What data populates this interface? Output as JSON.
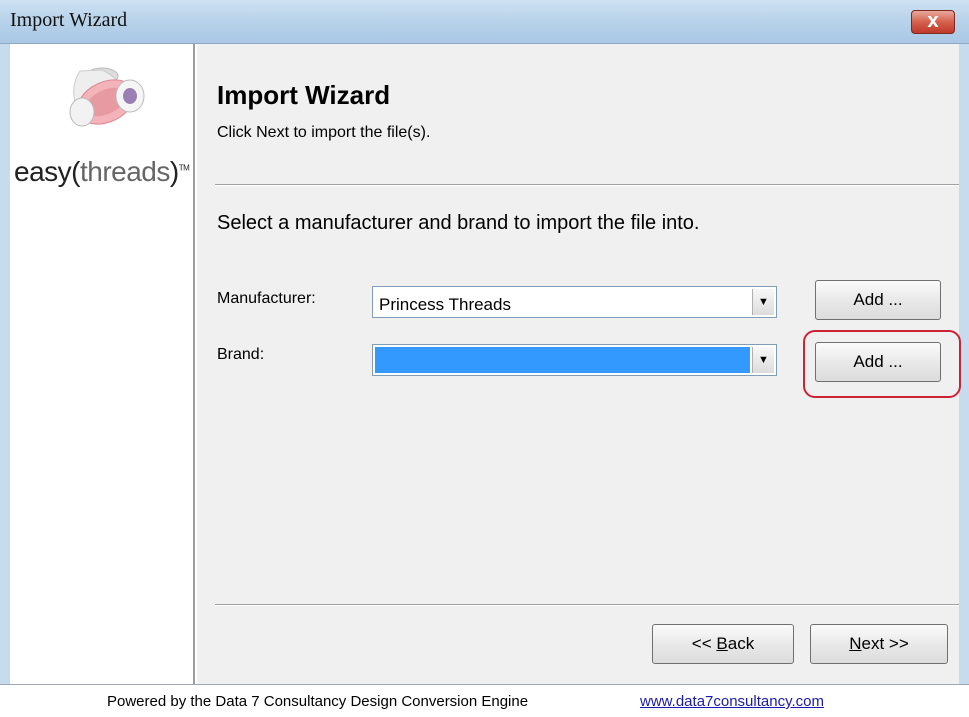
{
  "window": {
    "title": "Import Wizard",
    "close_label": "X"
  },
  "logo": {
    "text_bold": "easy",
    "text_light": "threads",
    "trademark": "TM"
  },
  "header": {
    "title": "Import Wizard",
    "subtitle": "Click Next to import the file(s)."
  },
  "form": {
    "instruction": "Select a manufacturer and brand to import the file into.",
    "manufacturer_label": "Manufacturer:",
    "manufacturer_value": "Princess Threads",
    "brand_label": "Brand:",
    "brand_value": "",
    "add_manufacturer_label": "Add ...",
    "add_brand_label": "Add ..."
  },
  "nav": {
    "back_prefix": "<< ",
    "back_mnemonic": "B",
    "back_rest": "ack",
    "next_mnemonic": "N",
    "next_rest": "ext >>"
  },
  "footer": {
    "text": "Powered by the Data 7 Consultancy Design Conversion Engine",
    "link": "www.data7consultancy.com"
  },
  "colors": {
    "selection": "#3399ff",
    "highlight_ring": "#cc2233",
    "titlebar": "#b9d3ea"
  }
}
